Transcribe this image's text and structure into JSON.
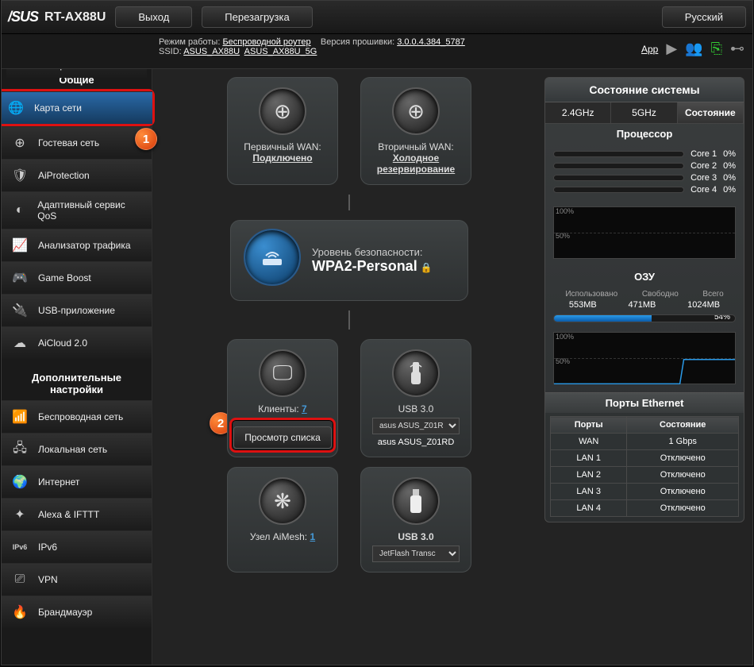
{
  "header": {
    "brand": "/SUS",
    "model": "RT-AX88U",
    "logout": "Выход",
    "reboot": "Перезагрузка",
    "language": "Русский"
  },
  "statusbar": {
    "mode_label": "Режим работы:",
    "mode_value": "Беспроводной роутер",
    "fw_label": "Версия прошивки:",
    "fw_value": "3.0.0.4.384_5787",
    "ssid_label": "SSID:",
    "ssid1": "ASUS_AX88U",
    "ssid2": "ASUS_AX88U_5G",
    "app": "App"
  },
  "sidebar": {
    "general": "Общие",
    "items": [
      {
        "label": "Карта сети"
      },
      {
        "label": "Гостевая сеть"
      },
      {
        "label": "AiProtection"
      },
      {
        "label": "Адаптивный сервис QoS"
      },
      {
        "label": "Анализатор трафика"
      },
      {
        "label": "Game Boost"
      },
      {
        "label": "USB-приложение"
      },
      {
        "label": "AiCloud 2.0"
      }
    ],
    "advanced": "Дополнительные настройки",
    "adv_items": [
      {
        "label": "Беспроводная сеть"
      },
      {
        "label": "Локальная сеть"
      },
      {
        "label": "Интернет"
      },
      {
        "label": "Alexa & IFTTT"
      },
      {
        "label": "IPv6"
      },
      {
        "label": "VPN"
      },
      {
        "label": "Брандмауэр"
      }
    ]
  },
  "map": {
    "wan1_label": "Первичный WAN:",
    "wan1_status": "Подключено",
    "wan2_label": "Вторичный WAN:",
    "wan2_status": "Холодное резервирование",
    "sec_label": "Уровень безопасности:",
    "sec_value": "WPA2-Personal",
    "clients_label": "Клиенты:",
    "clients_count": "7",
    "view_list": "Просмотр списка",
    "usb_a": "USB 3.0",
    "usb_a_device_sel": "asus ASUS_Z01RD",
    "usb_a_device": "asus ASUS_Z01RD",
    "aimesh_label": "Узел AiMesh:",
    "aimesh_count": "1",
    "usb_b": "USB 3.0",
    "usb_b_device": "JetFlash Transc"
  },
  "right": {
    "title": "Состояние системы",
    "tabs": {
      "a": "2.4GHz",
      "b": "5GHz",
      "c": "Состояние"
    },
    "cpu_title": "Процессор",
    "cpu": [
      {
        "name": "Core 1",
        "pct": "0%"
      },
      {
        "name": "Core 2",
        "pct": "0%"
      },
      {
        "name": "Core 3",
        "pct": "0%"
      },
      {
        "name": "Core 4",
        "pct": "0%"
      }
    ],
    "ram_title": "ОЗУ",
    "ram": {
      "used_l": "Использовано",
      "used_v": "553MB",
      "free_l": "Свободно",
      "free_v": "471MB",
      "total_l": "Всего",
      "total_v": "1024MB",
      "pct": "54%"
    },
    "eth_title": "Порты Ethernet",
    "eth_h1": "Порты",
    "eth_h2": "Состояние",
    "eth": [
      {
        "port": "WAN",
        "state": "1 Gbps"
      },
      {
        "port": "LAN 1",
        "state": "Отключено"
      },
      {
        "port": "LAN 2",
        "state": "Отключено"
      },
      {
        "port": "LAN 3",
        "state": "Отключено"
      },
      {
        "port": "LAN 4",
        "state": "Отключено"
      }
    ],
    "y100": "100%",
    "y50": "50%"
  }
}
